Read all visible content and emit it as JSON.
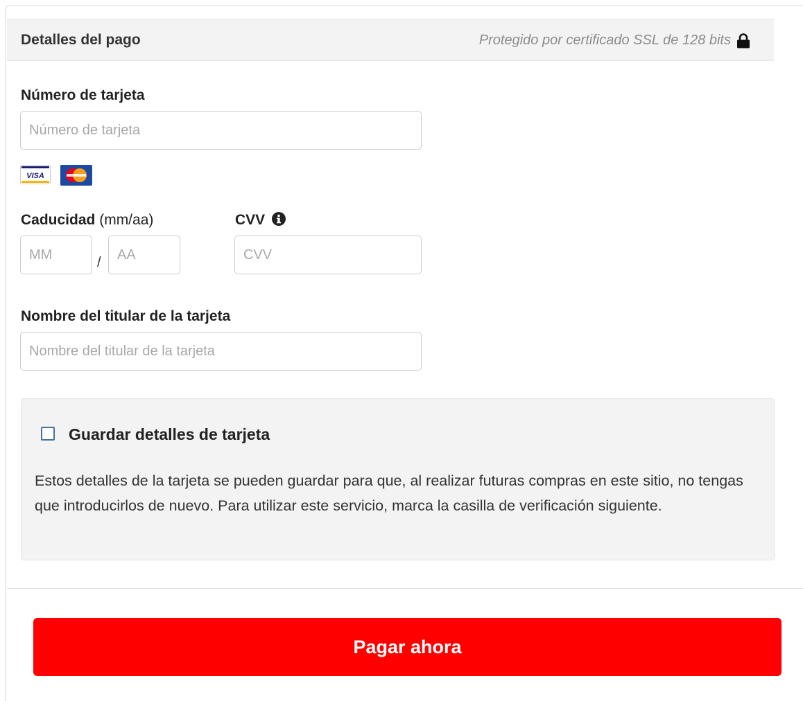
{
  "header": {
    "title": "Detalles del pago",
    "security_note": "Protegido por certificado SSL de 128 bits",
    "lock_icon": "lock-icon"
  },
  "card_number": {
    "label": "Número de tarjeta",
    "placeholder": "Número de tarjeta",
    "value": ""
  },
  "card_logos": [
    {
      "name": "VISA",
      "icon": "visa-logo"
    },
    {
      "name": "MasterCard",
      "icon": "mastercard-logo"
    }
  ],
  "expiry": {
    "label": "Caducidad",
    "hint": "(mm/aa)",
    "month_placeholder": "MM",
    "year_placeholder": "AA",
    "separator": "/"
  },
  "cvv": {
    "label": "CVV",
    "placeholder": "CVV",
    "info_icon": "info-icon"
  },
  "cardholder": {
    "label": "Nombre del titular de la tarjeta",
    "placeholder": "Nombre del titular de la tarjeta",
    "value": ""
  },
  "save_card": {
    "checked": false,
    "title": "Guardar detalles de tarjeta",
    "description": "Estos detalles de la tarjeta se pueden guardar para que, al realizar futuras compras en este sitio, no tengas que introducirlos de nuevo. Para utilizar este servicio, marca la casilla de verificación siguiente."
  },
  "pay_button": {
    "label": "Pagar ahora"
  },
  "colors": {
    "pay_button": "#ff0000",
    "header_bg": "#f3f3f3",
    "save_box_bg": "#f3f3f3",
    "checkbox_border": "#4a6f9c"
  }
}
